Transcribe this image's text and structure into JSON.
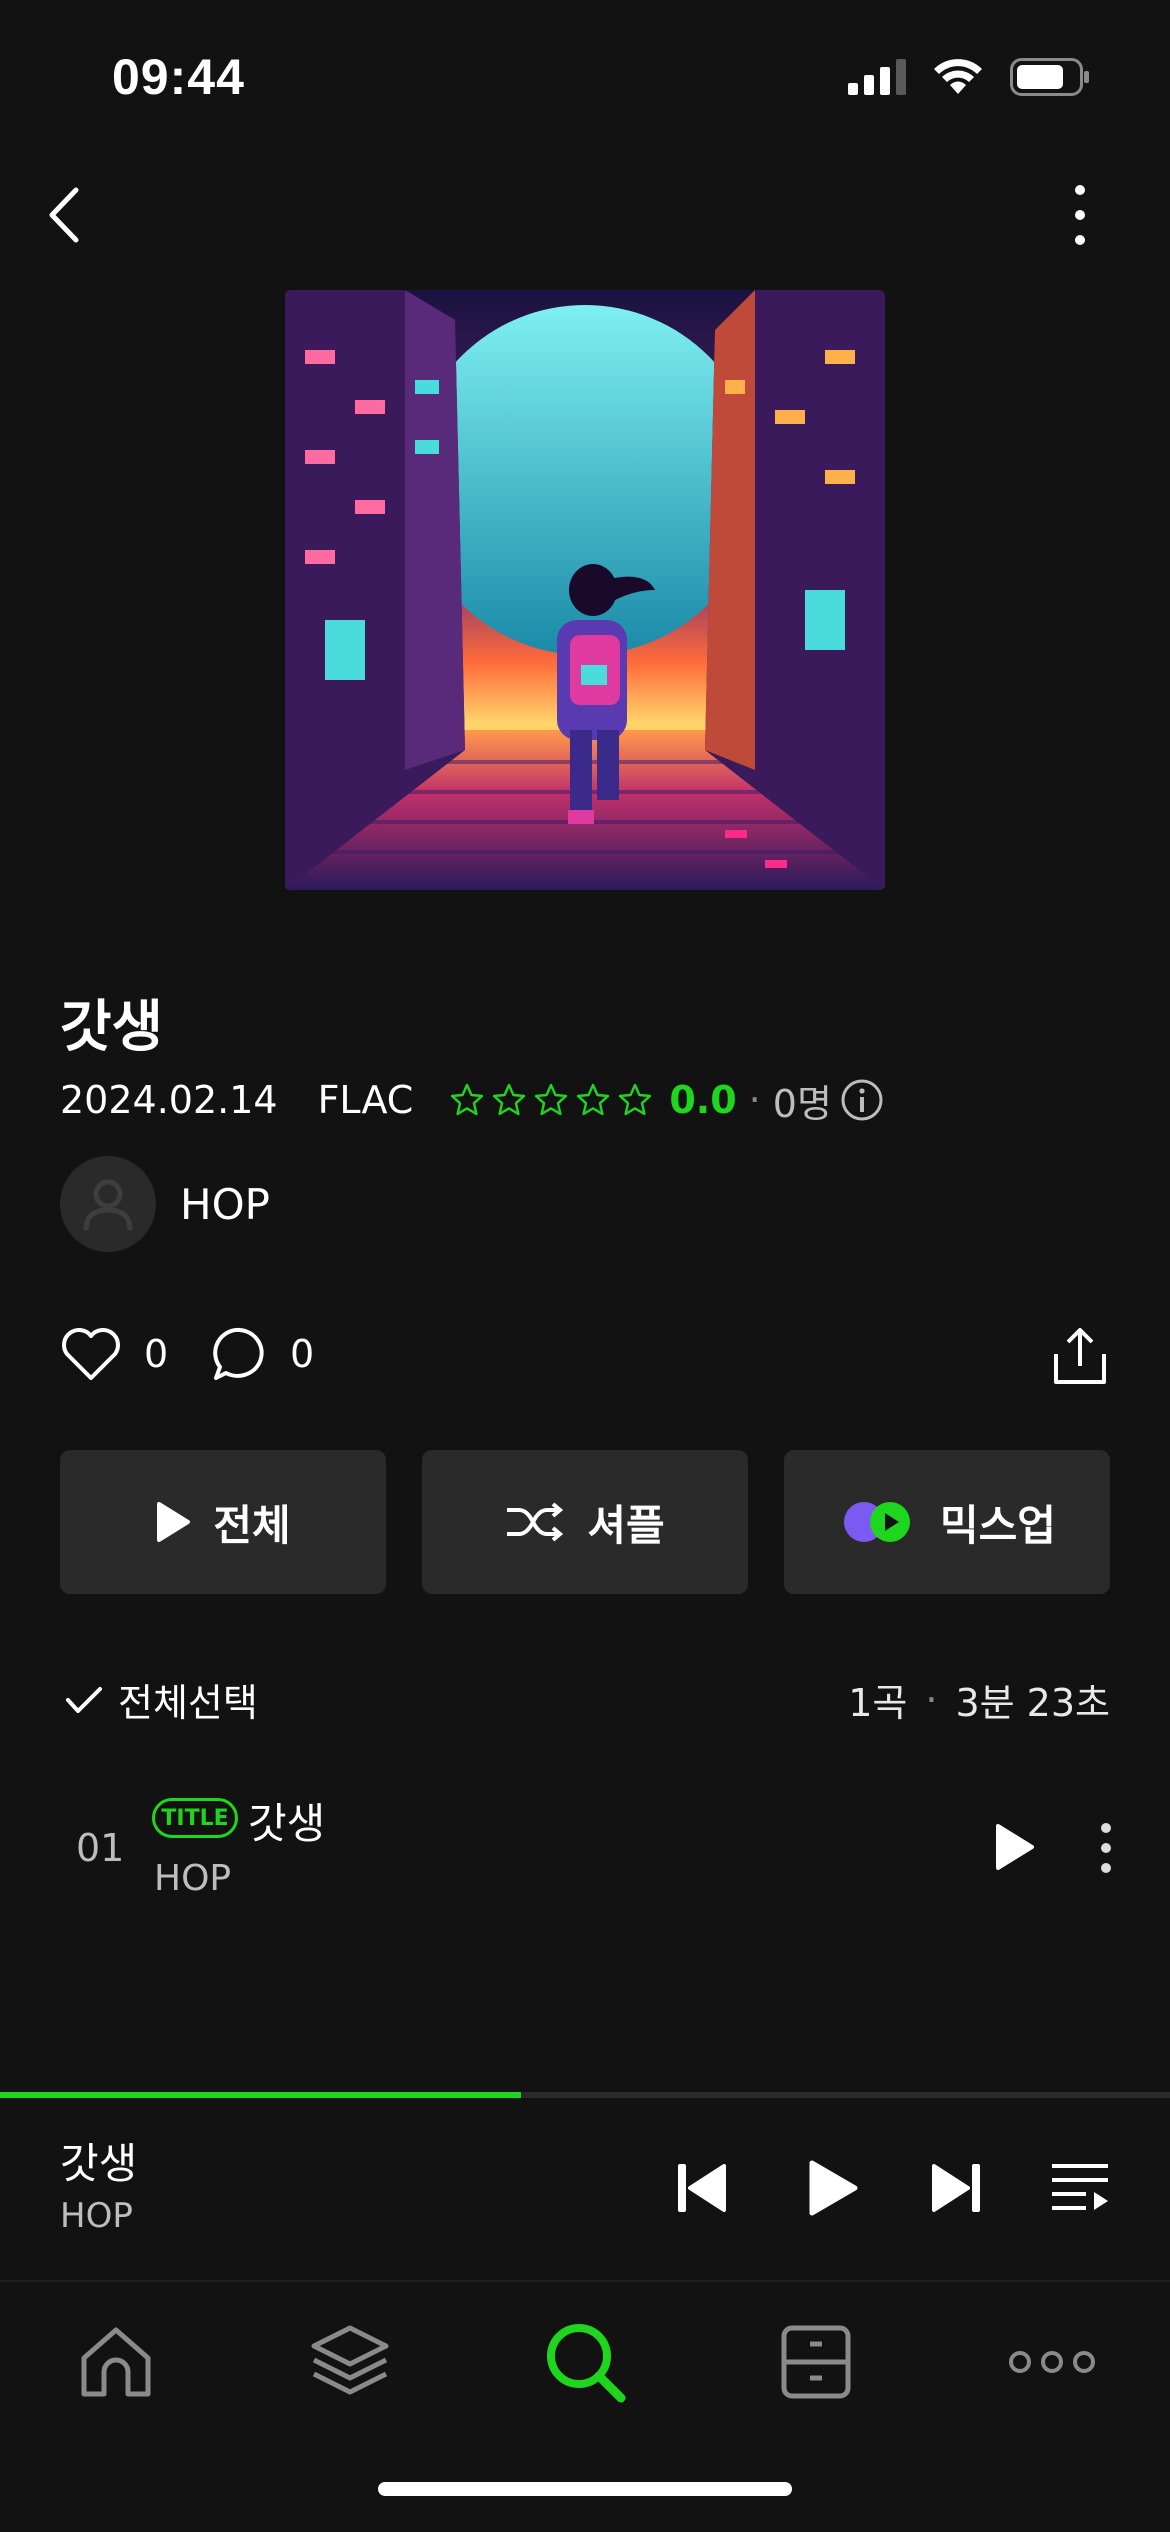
{
  "status_bar": {
    "time": "09:44"
  },
  "album": {
    "title": "갓생",
    "date": "2024.02.14",
    "format": "FLAC",
    "rating": "0.0",
    "rating_value": 0,
    "rating_max": 5,
    "votes": "0명"
  },
  "artist": {
    "name": "HOP"
  },
  "social": {
    "likes": "0",
    "comments": "0"
  },
  "actions": {
    "play_all": "전체",
    "shuffle": "셔플",
    "mixup": "믹스업"
  },
  "tracklist": {
    "select_all": "전체선택",
    "count": "1곡",
    "duration": "3분 23초",
    "tracks": [
      {
        "number": "01",
        "badge": "TITLE",
        "title": "갓생",
        "artist": "HOP"
      }
    ]
  },
  "mini_player": {
    "title": "갓생",
    "artist": "HOP",
    "progress": 0.445
  },
  "bottom_nav": [
    {
      "icon": "home-icon",
      "active": false
    },
    {
      "icon": "layers-icon",
      "active": false
    },
    {
      "icon": "search-icon",
      "active": true
    },
    {
      "icon": "cabinet-icon",
      "active": false
    },
    {
      "icon": "more-horizontal-icon",
      "active": false
    }
  ],
  "colors": {
    "accent": "#1ed61e",
    "background": "#121212",
    "button": "#2a2a2a"
  }
}
